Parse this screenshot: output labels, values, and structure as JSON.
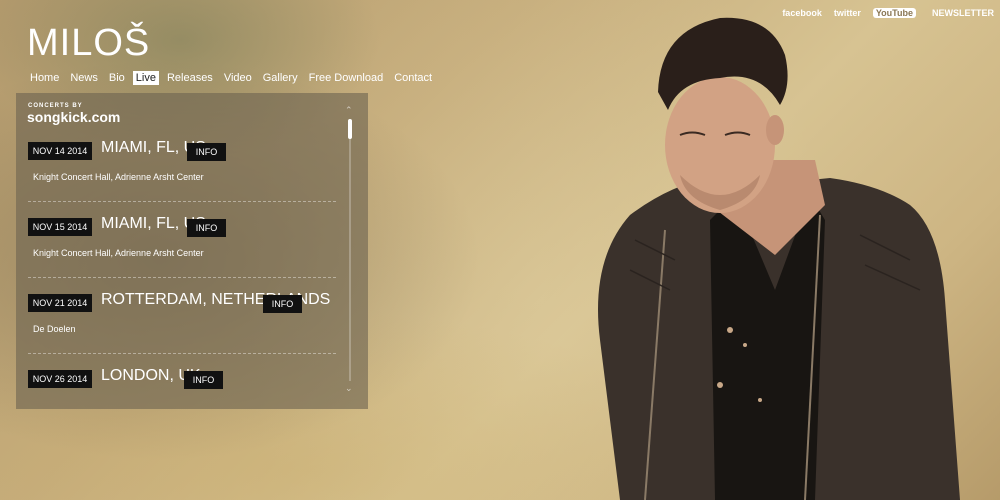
{
  "brand": {
    "name": "MILOŠ"
  },
  "nav": [
    {
      "label": "Home"
    },
    {
      "label": "News"
    },
    {
      "label": "Bio"
    },
    {
      "label": "Live"
    },
    {
      "label": "Releases"
    },
    {
      "label": "Video"
    },
    {
      "label": "Gallery"
    },
    {
      "label": "Free Download"
    },
    {
      "label": "Contact"
    }
  ],
  "social": {
    "facebook": "facebook",
    "twitter": "twitter",
    "youtube": "YouTube",
    "newsletter": "NEWSLETTER"
  },
  "songkick": {
    "small": "CONCERTS BY",
    "brand": "songkick.com"
  },
  "events": [
    {
      "date": "NOV 14 2014",
      "city": "MIAMI, FL, US",
      "info": "INFO",
      "venue": "Knight Concert Hall, Adrienne Arsht Center"
    },
    {
      "date": "NOV 15 2014",
      "city": "MIAMI, FL, US",
      "info": "INFO",
      "venue": "Knight Concert Hall, Adrienne Arsht Center"
    },
    {
      "date": "NOV 21 2014",
      "city": "ROTTERDAM, NETHERLANDS",
      "info": "INFO",
      "venue": "De Doelen"
    },
    {
      "date": "NOV 26 2014",
      "city": "LONDON, UK",
      "info": "INFO",
      "venue": ""
    }
  ],
  "colors": {
    "panel_bg": "#6e6450",
    "label_bg": "#111111",
    "text": "#ffffff"
  }
}
